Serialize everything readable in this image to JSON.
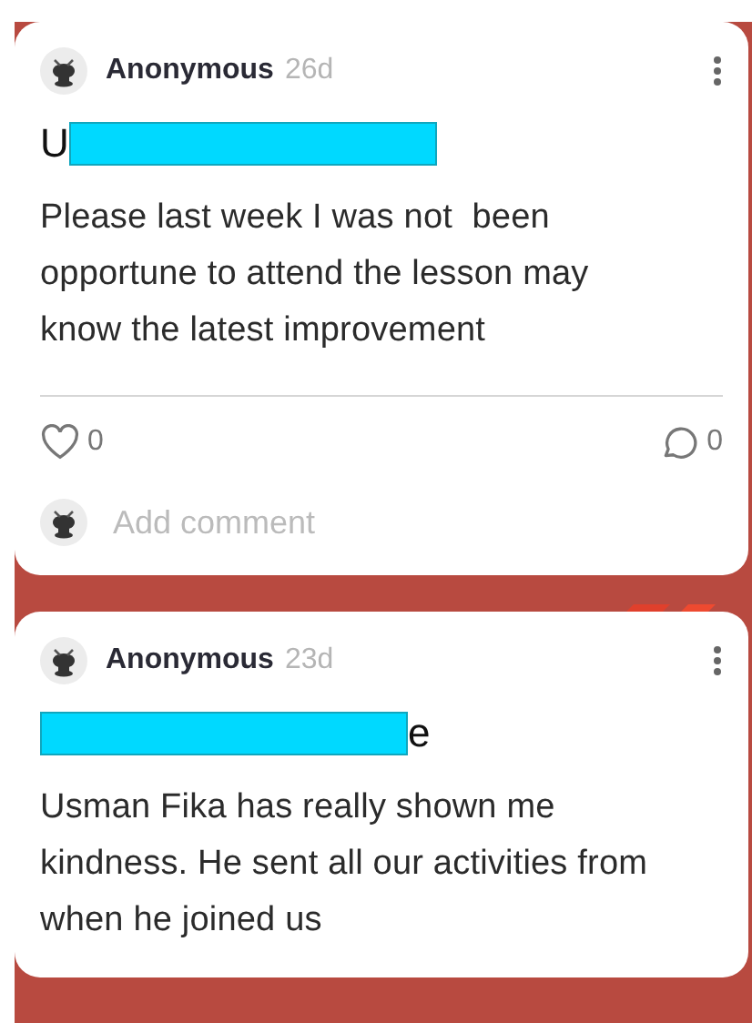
{
  "posts": [
    {
      "author": "Anonymous",
      "age": "26d",
      "title": {
        "before": "U",
        "redacted": true
      },
      "body": "Please last week I was not  been opportune to attend the lesson may know the latest improvement",
      "likes": "0",
      "comments": "0",
      "comment_placeholder": "Add comment"
    },
    {
      "author": "Anonymous",
      "age": "23d",
      "title": {
        "redacted": true,
        "after": "e"
      },
      "body": "Usman Fika has really shown me kindness. He sent all our activities from when he joined us"
    }
  ]
}
